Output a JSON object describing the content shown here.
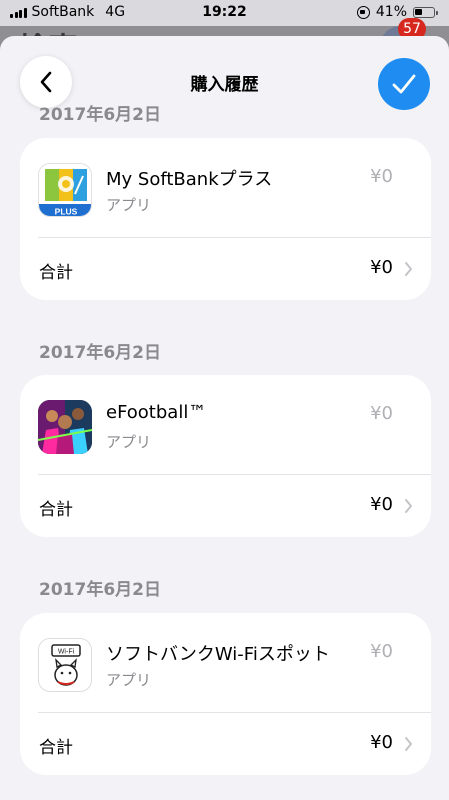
{
  "status_bar": {
    "carrier": "SoftBank",
    "network": "4G",
    "time": "19:22",
    "battery": "41%",
    "battery_level": 0.41
  },
  "background": {
    "title_fragment": "検索",
    "badge_count": "57"
  },
  "sheet": {
    "title": "購入履歴"
  },
  "purchases": [
    {
      "date": "2017年6月2日",
      "app_name": "My SoftBankプラス",
      "kind": "アプリ",
      "price": "¥0",
      "total_label": "合計",
      "total_value": "¥0",
      "icon": "my-softbank-plus-icon",
      "icon_text": "PLUS"
    },
    {
      "date": "2017年6月2日",
      "app_name": "eFootball™",
      "kind": "アプリ",
      "price": "¥0",
      "total_label": "合計",
      "total_value": "¥0",
      "icon": "efootball-icon"
    },
    {
      "date": "2017年6月2日",
      "app_name": "ソフトバンクWi-Fiスポット",
      "kind": "アプリ",
      "price": "¥0",
      "total_label": "合計",
      "total_value": "¥0",
      "icon": "softbank-wifi-spot-icon",
      "icon_text": "Wi-Fi"
    }
  ],
  "colors": {
    "accent": "#1e8cf0",
    "badge": "#d7281f",
    "secondary_text": "#8a8a8e",
    "sheet_bg": "#f2f2f7"
  }
}
